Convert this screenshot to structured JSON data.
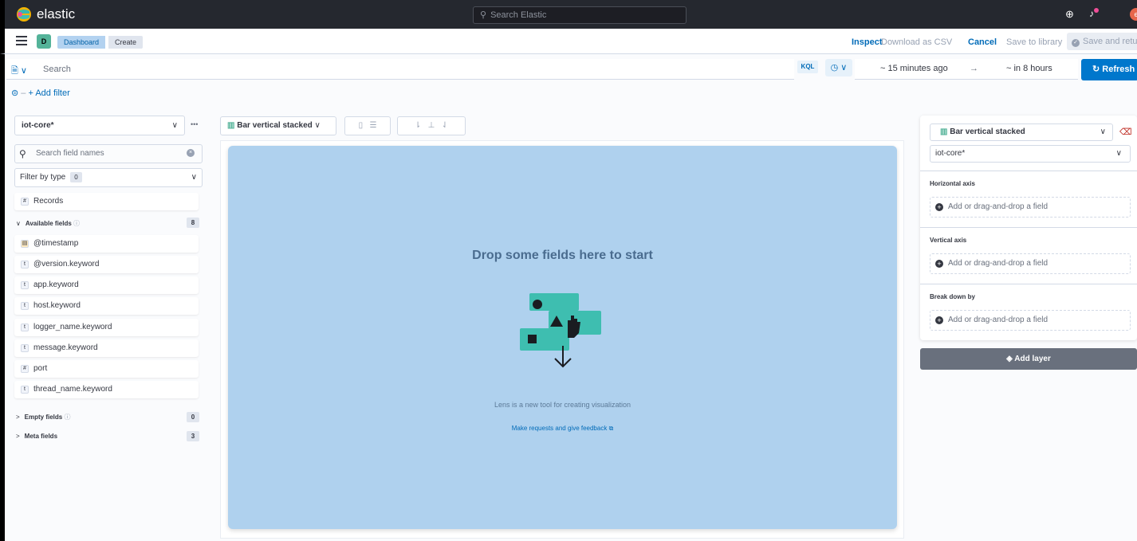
{
  "header": {
    "brand": "elastic",
    "search_placeholder": "Search Elastic"
  },
  "breadcrumbs": {
    "badge": "D",
    "items": [
      "Dashboard",
      "Create"
    ]
  },
  "top_actions": {
    "inspect": "Inspect",
    "download_csv": "Download as CSV",
    "cancel": "Cancel",
    "save_library": "Save to library",
    "save_return": "Save and return"
  },
  "query": {
    "placeholder": "Search",
    "language": "KQL",
    "start": "~ 15 minutes ago",
    "arrow": "→",
    "end": "~ in 8 hours",
    "refresh": "Refresh",
    "add_filter": "+ Add filter"
  },
  "left": {
    "index_pattern": "iot-core*",
    "field_search_placeholder": "Search field names",
    "filter_by_type": "Filter by type",
    "filter_count": "0",
    "records": "Records",
    "available_label": "Available fields",
    "available_count": "8",
    "fields": [
      {
        "name": "@timestamp",
        "type": "date"
      },
      {
        "name": "@version.keyword",
        "type": "t"
      },
      {
        "name": "app.keyword",
        "type": "t"
      },
      {
        "name": "host.keyword",
        "type": "t"
      },
      {
        "name": "logger_name.keyword",
        "type": "t"
      },
      {
        "name": "message.keyword",
        "type": "t"
      },
      {
        "name": "port",
        "type": "#"
      },
      {
        "name": "thread_name.keyword",
        "type": "t"
      }
    ],
    "empty_label": "Empty fields",
    "empty_count": "0",
    "meta_label": "Meta fields",
    "meta_count": "3"
  },
  "workspace": {
    "chart_type": "Bar vertical stacked",
    "drop_title": "Drop some fields here to start",
    "drop_subtitle": "Lens is a new tool for creating visualization",
    "feedback_link": "Make requests and give feedback"
  },
  "config": {
    "chart_type": "Bar vertical stacked",
    "index_pattern": "iot-core*",
    "horizontal_axis": "Horizontal axis",
    "vertical_axis": "Vertical axis",
    "break_down": "Break down by",
    "add_field": "Add or drag-and-drop a field",
    "add_layer": "Add layer"
  },
  "colors": {
    "primary": "#0077cc",
    "dropzone": "#afd1ee",
    "header_bg": "#25282f"
  }
}
